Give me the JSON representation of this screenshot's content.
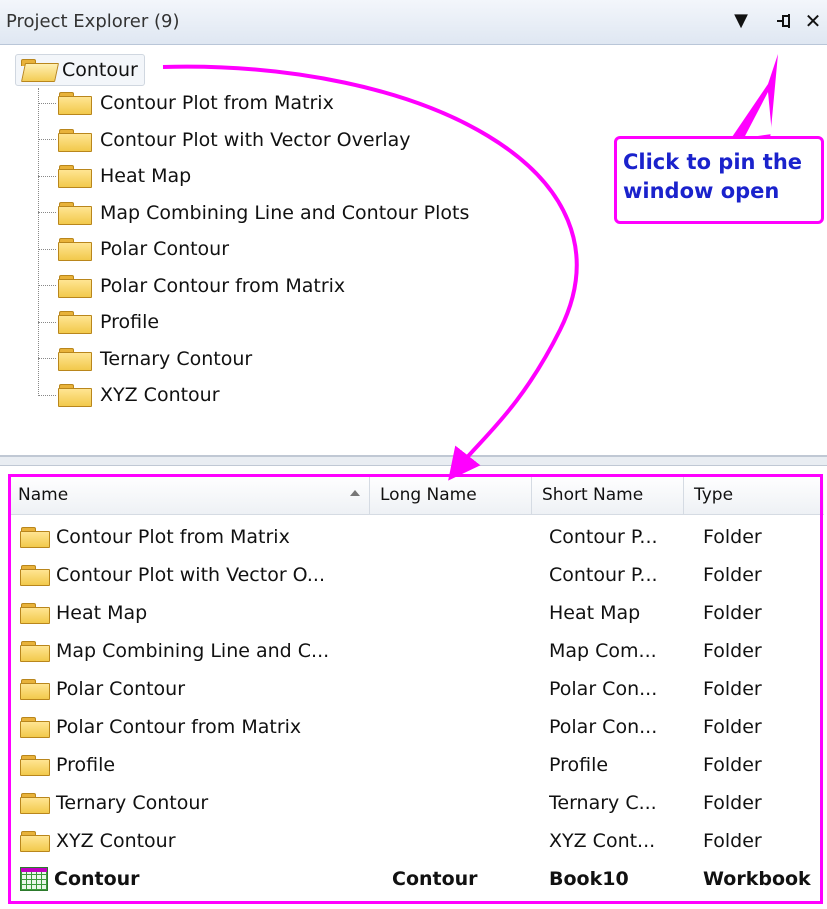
{
  "panel": {
    "title": "Project Explorer (9)"
  },
  "toolbar": {
    "dropdown_glyph": "▼",
    "pin_glyph": "⊣",
    "close_glyph": "✕"
  },
  "tree": {
    "root": "Contour",
    "children": [
      "Contour Plot from Matrix",
      "Contour Plot with Vector Overlay",
      "Heat Map",
      "Map Combining Line and Contour Plots",
      "Polar Contour",
      "Polar Contour from Matrix",
      "Profile",
      "Ternary Contour",
      "XYZ Contour"
    ]
  },
  "list": {
    "columns": [
      "Name",
      "Long Name",
      "Short Name",
      "Type"
    ],
    "rows": [
      {
        "icon": "folder-icon",
        "name": "Contour Plot from Matrix",
        "long_name": "",
        "short_name": "Contour P...",
        "type": "Folder"
      },
      {
        "icon": "folder-icon",
        "name": "Contour Plot with Vector O...",
        "long_name": "",
        "short_name": "Contour P...",
        "type": "Folder"
      },
      {
        "icon": "folder-icon",
        "name": "Heat Map",
        "long_name": "",
        "short_name": "Heat Map",
        "type": "Folder"
      },
      {
        "icon": "folder-icon",
        "name": "Map Combining Line and C...",
        "long_name": "",
        "short_name": "Map Com...",
        "type": "Folder"
      },
      {
        "icon": "folder-icon",
        "name": "Polar Contour",
        "long_name": "",
        "short_name": "Polar Con...",
        "type": "Folder"
      },
      {
        "icon": "folder-icon",
        "name": "Polar Contour from Matrix",
        "long_name": "",
        "short_name": "Polar Con...",
        "type": "Folder"
      },
      {
        "icon": "folder-icon",
        "name": "Profile",
        "long_name": "",
        "short_name": "Profile",
        "type": "Folder"
      },
      {
        "icon": "folder-icon",
        "name": "Ternary Contour",
        "long_name": "",
        "short_name": "Ternary C...",
        "type": "Folder"
      },
      {
        "icon": "folder-icon",
        "name": "XYZ Contour",
        "long_name": "",
        "short_name": "XYZ Cont...",
        "type": "Folder"
      },
      {
        "icon": "workbook-icon",
        "name": "Contour",
        "long_name": "Contour",
        "short_name": "Book10",
        "type": "Workbook"
      }
    ]
  },
  "annotation": {
    "text": "Click to pin the window open",
    "color": "#ff00ff",
    "text_color": "#1a22cc"
  }
}
